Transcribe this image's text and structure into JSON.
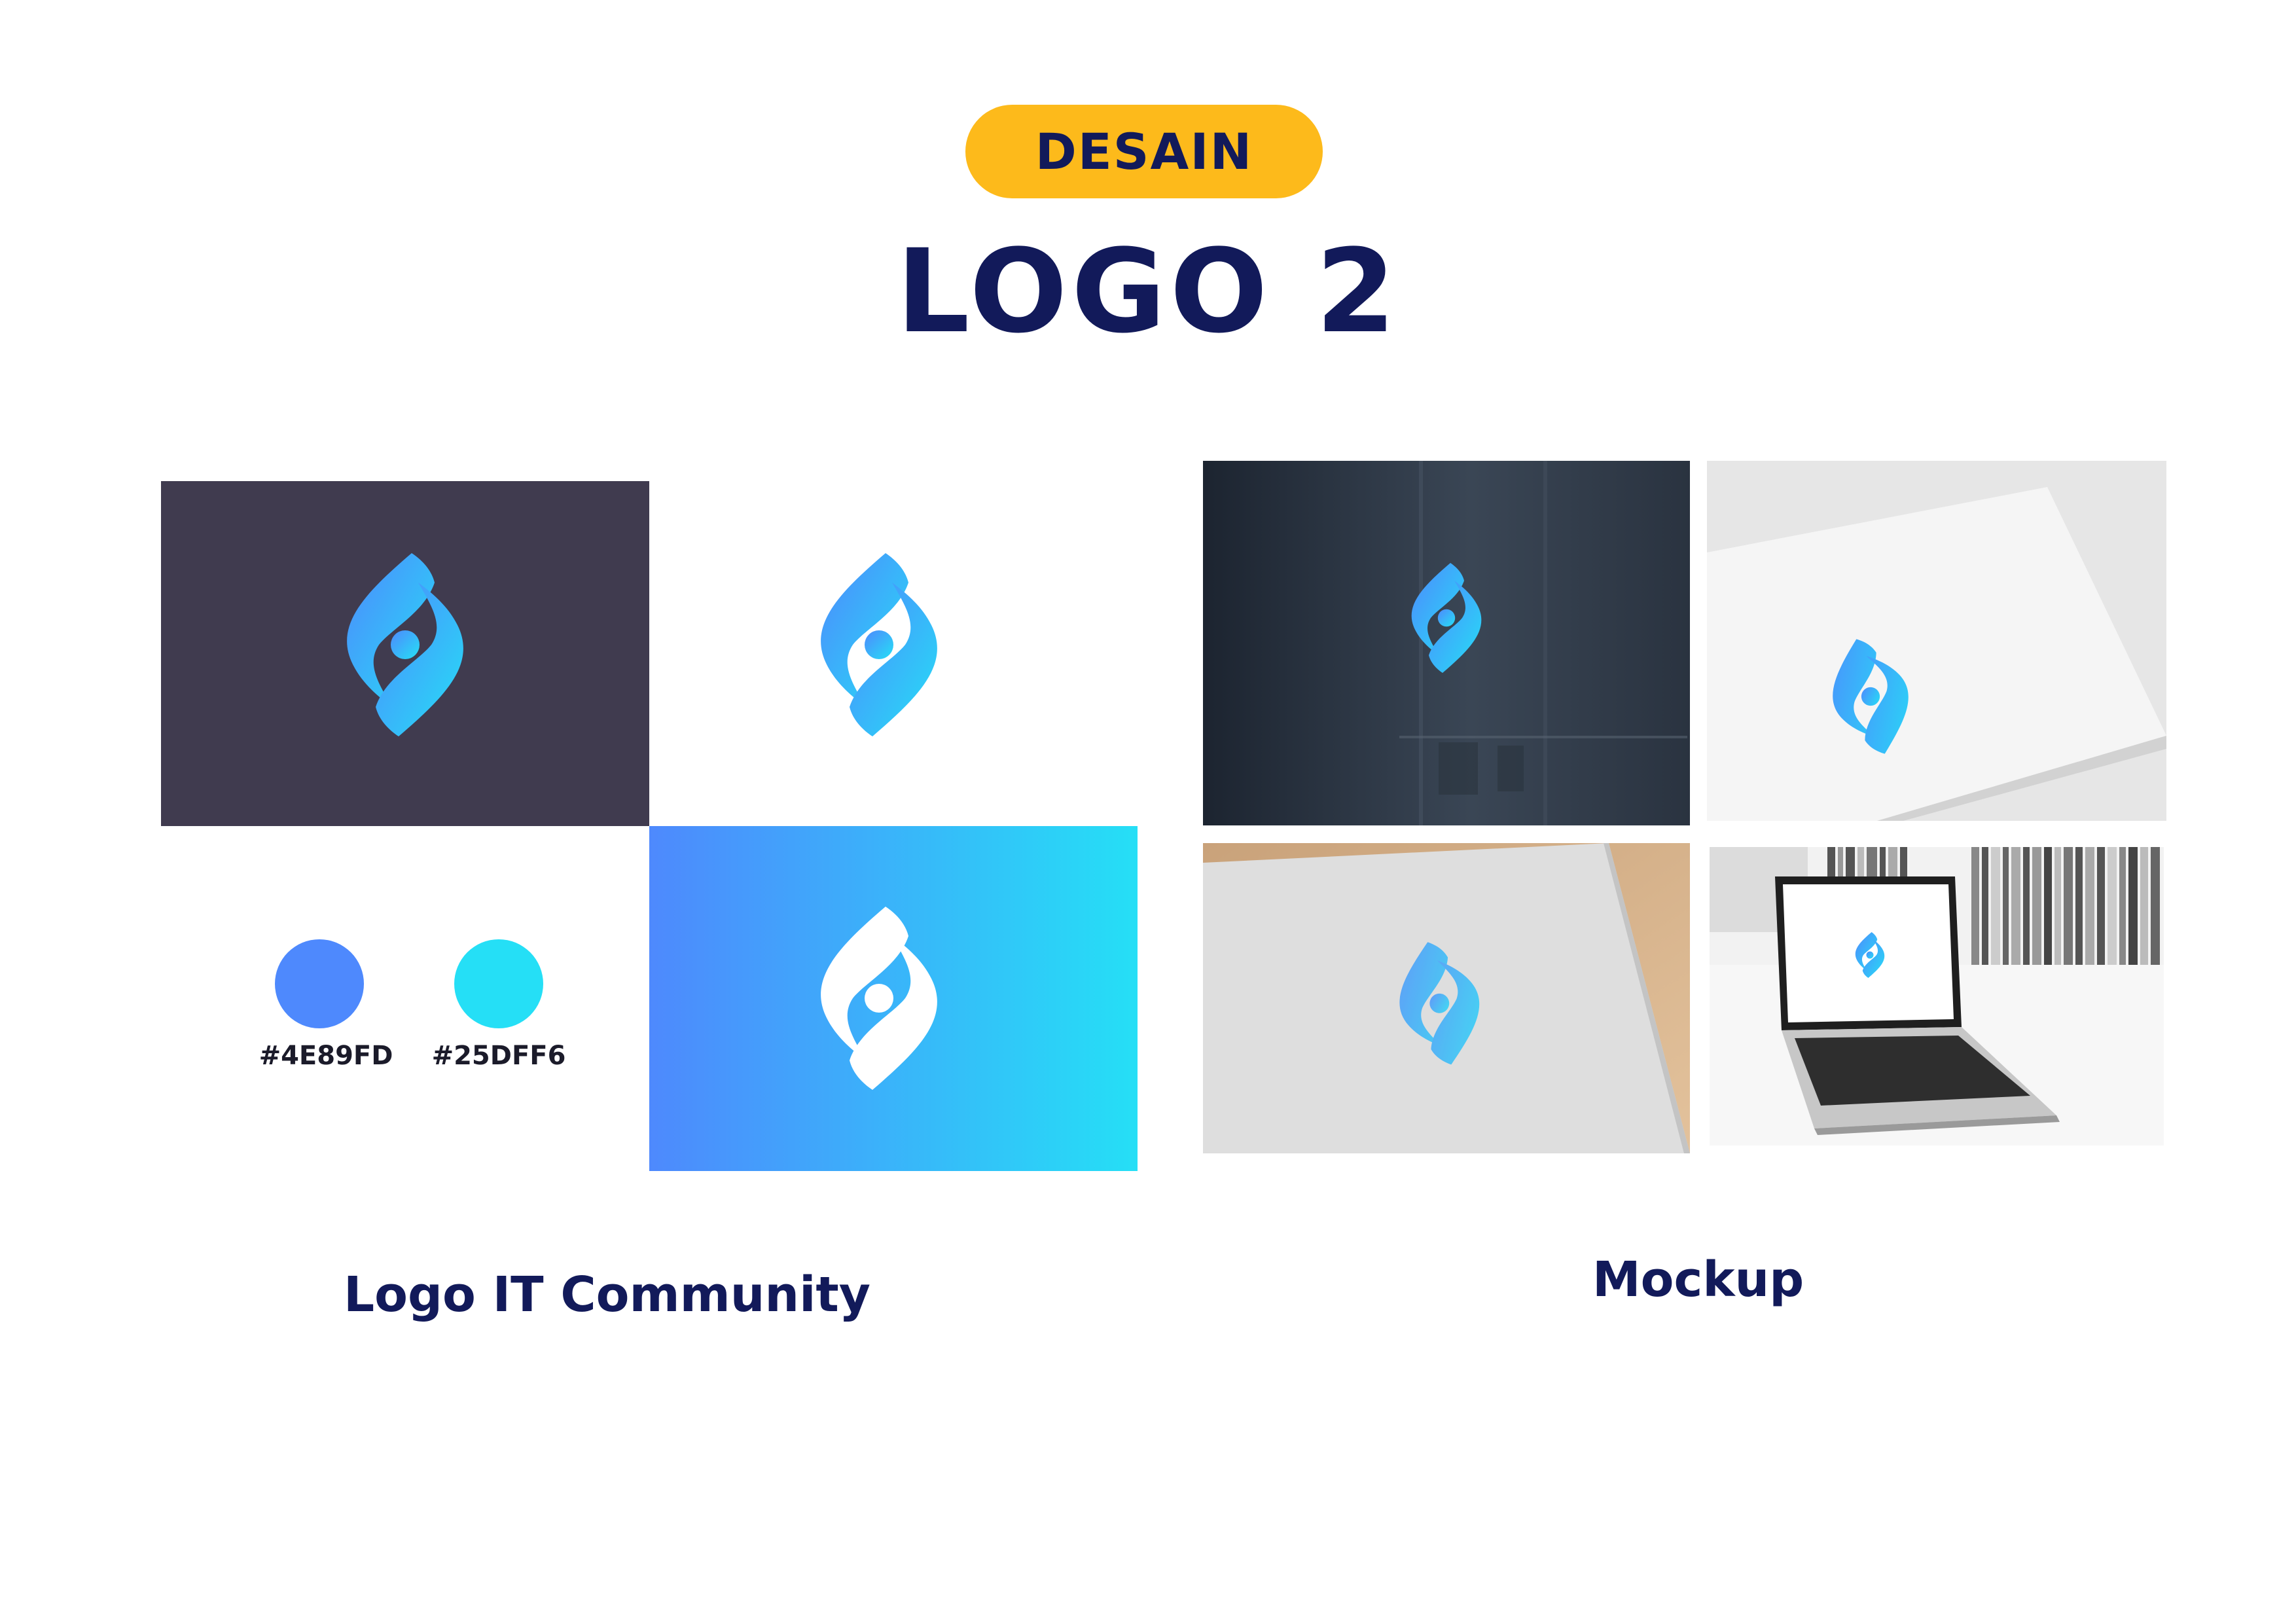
{
  "badge": "DESAIN",
  "title": "LOGO 2",
  "palette": [
    {
      "hex": "#4E89FD",
      "color": "#4E89FD"
    },
    {
      "hex": "#25DFF6",
      "color": "#25DFF6"
    }
  ],
  "captions": {
    "left": "Logo IT Community",
    "right": "Mockup"
  },
  "colors": {
    "badge_bg": "#FDBA1B",
    "title_text": "#121A5A",
    "dark_panel": "#403B4F",
    "gradient_start": "#4E89FD",
    "gradient_end": "#25DFF6"
  },
  "icons": {
    "logo": "it-community-logo-icon"
  }
}
